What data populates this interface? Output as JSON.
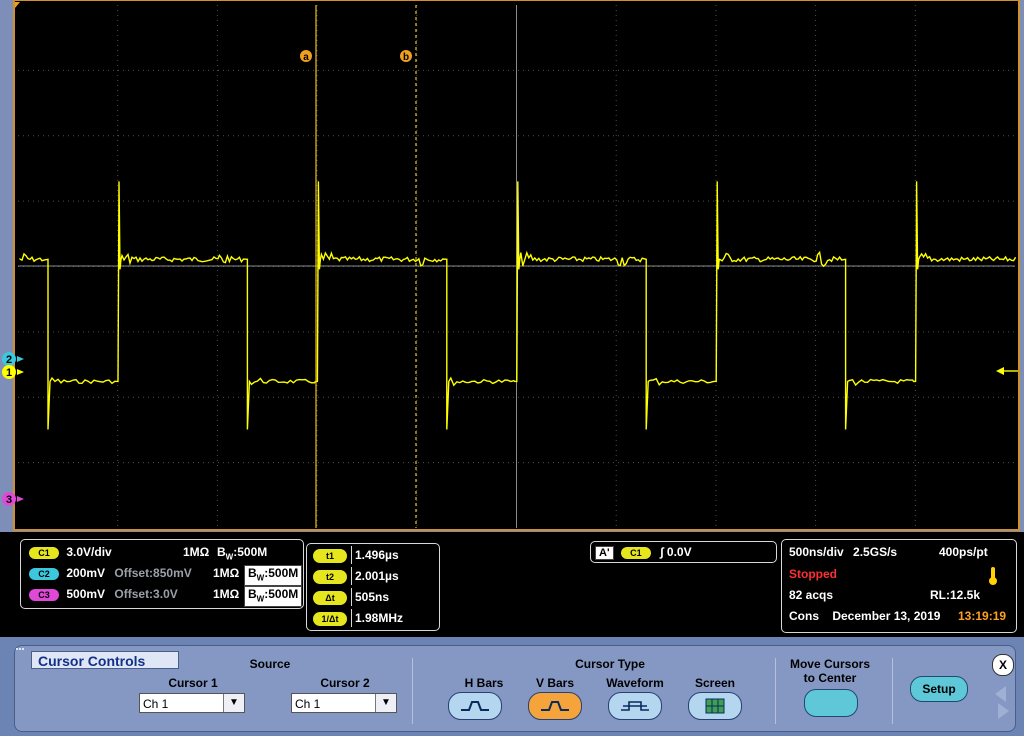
{
  "screen": {
    "cursor_a_label": "a",
    "cursor_b_label": "b",
    "ch2_marker": "2",
    "ch1_marker": "1",
    "ch3_marker": "3"
  },
  "chart_data": {
    "type": "line",
    "series": [
      {
        "name": "",
        "color": "#ffff00",
        "period_us": 1.0,
        "high_level_div": -0.5,
        "low_level_div": 2.5
      }
    ],
    "xlim_us": [
      0,
      5
    ],
    "grid": true
  },
  "channels": {
    "c1": {
      "badge": "C1",
      "scale": "3.0V/div",
      "imp": "1MΩ",
      "bw_prefix": "B",
      "bw_sub": "W",
      "bw": ":500M"
    },
    "c2": {
      "badge": "C2",
      "scale": "200mV",
      "offset": "Offset:850mV",
      "imp": "1MΩ",
      "bw_prefix": "B",
      "bw_sub": "W",
      "bw": ":500M"
    },
    "c3": {
      "badge": "C3",
      "scale": "500mV",
      "offset": "Offset:3.0V",
      "imp": "1MΩ",
      "bw_prefix": "B",
      "bw_sub": "W",
      "bw": ":500M"
    }
  },
  "cursors_readout": {
    "t1_label": "t1",
    "t1": "1.496µs",
    "t2_label": "t2",
    "t2": "2.001µs",
    "dt_label": "Δt",
    "dt": "505ns",
    "inv_label": "1/Δt",
    "inv": "1.98MHz"
  },
  "trigger": {
    "mode": "A'",
    "source": "C1",
    "level": "0.0V"
  },
  "acquisition": {
    "timebase": "500ns/div",
    "rate": "2.5GS/s",
    "resolution": "400ps/pt",
    "status": "Stopped",
    "acqs": "82 acqs",
    "rl": "RL:12.5k",
    "mode": "Cons",
    "date": "December 13, 2019",
    "time": "13:19:19"
  },
  "panel": {
    "title": "Cursor Controls",
    "source_label": "Source",
    "cursor1_label": "Cursor 1",
    "cursor1_value": "Ch 1",
    "cursor2_label": "Cursor 2",
    "cursor2_value": "Ch 1",
    "cursor_type_label": "Cursor Type",
    "types": [
      "H Bars",
      "V Bars",
      "Waveform",
      "Screen"
    ],
    "active_type": "V Bars",
    "move_label_1": "Move Cursors",
    "move_label_2": "to Center",
    "setup_label": "Setup",
    "close_label": "X"
  }
}
